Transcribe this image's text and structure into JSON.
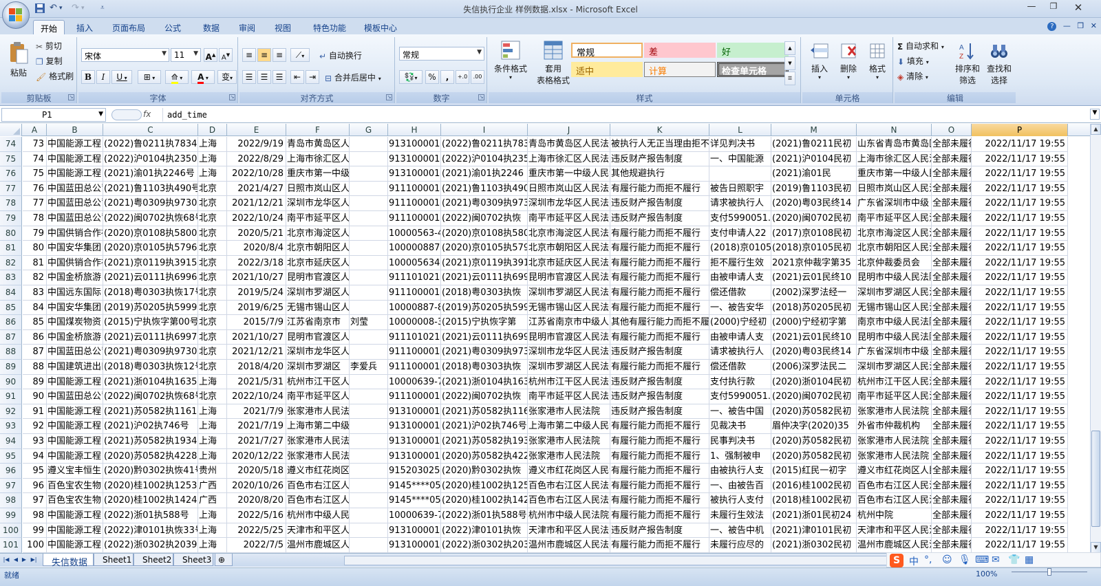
{
  "window": {
    "title": "失信执行企业 样例数据.xlsx - Microsoft Excel",
    "qat": [
      "save-icon",
      "undo-icon",
      "redo-icon"
    ],
    "controls": [
      "minimize-icon",
      "restore-icon",
      "close-icon"
    ]
  },
  "ribbon": {
    "tabs": [
      "开始",
      "插入",
      "页面布局",
      "公式",
      "数据",
      "审阅",
      "视图",
      "特色功能",
      "模板中心"
    ],
    "active_tab": "开始",
    "clipboard": {
      "paste": "粘贴",
      "cut": "剪切",
      "copy": "复制",
      "format_painter": "格式刷",
      "label": "剪贴板"
    },
    "font": {
      "name": "宋体",
      "size": "11",
      "label": "字体",
      "bold": "B",
      "italic": "I",
      "underline": "U",
      "grow": "A",
      "shrink": "A",
      "font_color_glyph": "A",
      "phonetic": "变"
    },
    "alignment": {
      "wrap": "自动换行",
      "merge": "合并后居中",
      "label": "对齐方式"
    },
    "number": {
      "format": "常规",
      "label": "数字",
      "percent": "%",
      "comma": ","
    },
    "styles": {
      "conditional": "条件格式",
      "table_format_1": "套用",
      "table_format_2": "表格格式",
      "label": "样式",
      "cells": [
        {
          "text": "常规",
          "bg": "#ffffff",
          "color": "#000000",
          "border": "#f0b060"
        },
        {
          "text": "差",
          "bg": "#ffc7ce",
          "color": "#9c0006",
          "border": "#ffc7ce"
        },
        {
          "text": "好",
          "bg": "#c6efce",
          "color": "#006100",
          "border": "#c6efce"
        },
        {
          "text": "适中",
          "bg": "#ffeb9c",
          "color": "#9c6500",
          "border": "#ffeb9c"
        },
        {
          "text": "计算",
          "bg": "#f2f2f2",
          "color": "#fa7d00",
          "border": "#7f7f7f"
        },
        {
          "text": "检查单元格",
          "bg": "#a5a5a5",
          "color": "#ffffff",
          "border": "#3f3f3f"
        }
      ]
    },
    "cells_group": {
      "insert": "插入",
      "delete": "删除",
      "format": "格式",
      "label": "单元格"
    },
    "editing": {
      "autosum": "自动求和",
      "fill": "填充",
      "clear": "清除",
      "sort_1": "排序和",
      "sort_2": "筛选",
      "find_1": "查找和",
      "find_2": "选择",
      "label": "编辑"
    }
  },
  "formula_bar": {
    "name_box": "P1",
    "fx": "fx",
    "content": "add_time"
  },
  "columns": [
    {
      "key": "A",
      "w": 35
    },
    {
      "key": "B",
      "w": 82
    },
    {
      "key": "C",
      "w": 138
    },
    {
      "key": "D",
      "w": 42
    },
    {
      "key": "E",
      "w": 86
    },
    {
      "key": "F",
      "w": 92
    },
    {
      "key": "G",
      "w": 56
    },
    {
      "key": "H",
      "w": 77
    },
    {
      "key": "I",
      "w": 126
    },
    {
      "key": "J",
      "w": 120
    },
    {
      "key": "K",
      "w": 144
    },
    {
      "key": "L",
      "w": 90
    },
    {
      "key": "M",
      "w": 124
    },
    {
      "key": "N",
      "w": 109
    },
    {
      "key": "O",
      "w": 58
    },
    {
      "key": "P",
      "w": 140
    }
  ],
  "selected_column": "P",
  "rows": [
    {
      "n": "74",
      "cells": [
        "73",
        "中国能源工程",
        "(2022)鲁0211执7834号",
        "上海",
        "2022/9/19",
        "青岛市黄岛区人民法院",
        "",
        "913100001",
        "(2022)鲁0211执7834",
        "青岛市黄岛区人民法院",
        "被执行人无正当理由拒不履行",
        "详见判决书",
        "(2021)鲁0211民初",
        "山东省青岛市黄岛区",
        "全部未履行",
        "2022/11/17 19:55"
      ]
    },
    {
      "n": "75",
      "cells": [
        "74",
        "中国能源工程",
        "(2022)沪0104执2350号",
        "上海",
        "2022/8/29",
        "上海市徐汇区人民法院",
        "",
        "913100001",
        "(2022)沪0104执2350",
        "上海市徐汇区人民法院",
        "违反财产报告制度",
        "一、中国能源",
        "(2021)沪0104民初",
        "上海市徐汇区人民法院",
        "全部未履行",
        "2022/11/17 19:55"
      ]
    },
    {
      "n": "76",
      "cells": [
        "75",
        "中国能源工程",
        "(2021)渝01执2246号",
        "上海",
        "2022/10/28",
        "重庆市第一中级人民法院",
        "",
        "913100001",
        "(2021)渝01执2246",
        "重庆市第一中级人民法院",
        "其他规避执行",
        "",
        "(2021)渝01民",
        "重庆市第一中级人民法院",
        "全部未履行",
        "2022/11/17 19:55"
      ]
    },
    {
      "n": "77",
      "cells": [
        "76",
        "中国蓝田总公司",
        "(2021)鲁1103执490号",
        "北京",
        "2021/4/27",
        "日照市岚山区人民法院",
        "",
        "911100001",
        "(2021)鲁1103执490",
        "日照市岚山区人民法院",
        "有履行能力而拒不履行",
        "被告日照职宇",
        "(2019)鲁1103民初",
        "日照市岚山区人民法院",
        "全部未履行",
        "2022/11/17 19:55"
      ]
    },
    {
      "n": "78",
      "cells": [
        "77",
        "中国蓝田总公司",
        "(2021)粤0309执9730号",
        "北京",
        "2021/12/21",
        "深圳市龙华区人民法院",
        "",
        "911100001",
        "(2021)粤0309执9730",
        "深圳市龙华区人民法院",
        "违反财产报告制度",
        "请求被执行人",
        "(2020)粤03民终14",
        "广东省深圳市中级",
        "全部未履行",
        "2022/11/17 19:55"
      ]
    },
    {
      "n": "79",
      "cells": [
        "78",
        "中国蓝田总公司",
        "(2022)闽0702执恢68号",
        "北京",
        "2022/10/24",
        "南平市延平区人民法院",
        "",
        "911100001",
        "(2022)闽0702执恢",
        "南平市延平区人民法院",
        "违反财产报告制度",
        "支付5990051.",
        "(2020)闽0702民初",
        "南平市延平区人民法院",
        "全部未履行",
        "2022/11/17 19:55"
      ]
    },
    {
      "n": "80",
      "cells": [
        "79",
        "中国供销合作社",
        "(2020)京0108执5800号",
        "北京",
        "2020/5/21",
        "北京市海淀区人民法院",
        "",
        "10000563-4",
        "(2020)京0108执5800",
        "北京市海淀区人民法院",
        "有履行能力而拒不履行",
        "支付申请人22",
        "(2017)京0108民初",
        "北京市海淀区人民法院",
        "全部未履行",
        "2022/11/17 19:55"
      ]
    },
    {
      "n": "81",
      "cells": [
        "80",
        "中国安华集团",
        "(2020)京0105执5796号",
        "北京",
        "2020/8/4",
        "北京市朝阳区人民法院",
        "",
        "100000887-8",
        "(2020)京0105执5796",
        "北京市朝阳区人民法院",
        "有履行能力而拒不履行",
        "(2018)京0105",
        "(2018)京0105民初",
        "北京市朝阳区人民法院",
        "全部未履行",
        "2022/11/17 19:55"
      ]
    },
    {
      "n": "82",
      "cells": [
        "81",
        "中国供销合作社",
        "(2021)京0119执3915号",
        "北京",
        "2022/3/18",
        "北京市延庆区人民法院",
        "",
        "100005634",
        "(2021)京0119执3915",
        "北京市延庆区人民法院",
        "有履行能力而拒不履行",
        "拒不履行生效",
        "2021京仲裁字第35",
        "北京仲裁委员会",
        "全部未履行",
        "2022/11/17 19:55"
      ]
    },
    {
      "n": "83",
      "cells": [
        "82",
        "中国金桥旅游",
        "(2021)云0111执6996号",
        "北京",
        "2021/10/27",
        "昆明市官渡区人民法院",
        "",
        "911101021",
        "(2021)云0111执6996",
        "昆明市官渡区人民法院",
        "有履行能力而拒不履行",
        "由被申请人支",
        "(2021)云01民终10",
        "昆明市中级人民法院",
        "全部未履行",
        "2022/11/17 19:55"
      ]
    },
    {
      "n": "84",
      "cells": [
        "83",
        "中国远东国际",
        "(2018)粤0303执恢17号",
        "北京",
        "2019/5/24",
        "深圳市罗湖区人民法院",
        "",
        "911100001",
        "(2018)粤0303执恢",
        "深圳市罗湖区人民法院",
        "有履行能力而拒不履行",
        "偿还借款",
        "(2002)深罗法经一",
        "深圳市罗湖区人民法院",
        "全部未履行",
        "2022/11/17 19:55"
      ]
    },
    {
      "n": "85",
      "cells": [
        "84",
        "中国安华集团",
        "(2019)苏0205执5999号",
        "北京",
        "2019/6/25",
        "无锡市锡山区人民法院",
        "",
        "10000887-8",
        "(2019)苏0205执5999",
        "无锡市锡山区人民法院",
        "有履行能力而拒不履行",
        "一、被告安华",
        "(2018)苏0205民初",
        "无锡市锡山区人民法院",
        "全部未履行",
        "2022/11/17 19:55"
      ]
    },
    {
      "n": "86",
      "cells": [
        "85",
        "中国煤炭物资",
        "(2015)宁执恢字第00号",
        "北京",
        "2015/7/9",
        "江苏省南京市",
        "刘莹",
        "10000008-3",
        "(2015)宁执恢字第",
        "江苏省南京市中级人民法院",
        "其他有履行能力而拒不履行",
        "(2000)宁经初",
        "(2000)宁经初字第",
        "南京市中级人民法院",
        "全部未履行",
        "2022/11/17 19:55"
      ]
    },
    {
      "n": "87",
      "cells": [
        "86",
        "中国金桥旅游",
        "(2021)云0111执6997号",
        "北京",
        "2021/10/27",
        "昆明市官渡区人民法院",
        "",
        "911101021",
        "(2021)云0111执6997",
        "昆明市官渡区人民法院",
        "有履行能力而拒不履行",
        "由被申请人支",
        "(2021)云01民终10",
        "昆明市中级人民法院",
        "全部未履行",
        "2022/11/17 19:55"
      ]
    },
    {
      "n": "88",
      "cells": [
        "87",
        "中国蓝田总公司",
        "(2021)粤0309执9730号",
        "北京",
        "2021/12/21",
        "深圳市龙华区人民法院",
        "",
        "911100001",
        "(2021)粤0309执9730",
        "深圳市龙华区人民法院",
        "违反财产报告制度",
        "请求被执行人",
        "(2020)粤03民终14",
        "广东省深圳市中级",
        "全部未履行",
        "2022/11/17 19:55"
      ]
    },
    {
      "n": "89",
      "cells": [
        "88",
        "中国建筑进出口",
        "(2018)粤0303执恢12号",
        "北京",
        "2018/4/20",
        "深圳市罗湖区",
        "李爱兵",
        "911100001",
        "(2018)粤0303执恢",
        "深圳市罗湖区人民法院",
        "有履行能力而拒不履行",
        "偿还借款",
        "(2006)深罗法民二",
        "深圳市罗湖区人民法院",
        "全部未履行",
        "2022/11/17 19:55"
      ]
    },
    {
      "n": "90",
      "cells": [
        "89",
        "中国能源工程",
        "(2021)浙0104执1635号",
        "上海",
        "2021/5/31",
        "杭州市江干区人民法院",
        "",
        "10000639-7",
        "(2021)浙0104执1635",
        "杭州市江干区人民法院",
        "违反财产报告制度",
        "支付执行款",
        "(2020)浙0104民初",
        "杭州市江干区人民法院",
        "全部未履行",
        "2022/11/17 19:55"
      ]
    },
    {
      "n": "91",
      "cells": [
        "90",
        "中国蓝田总公司",
        "(2022)闽0702执恢68号",
        "北京",
        "2022/10/24",
        "南平市延平区人民法院",
        "",
        "911100001",
        "(2022)闽0702执恢",
        "南平市延平区人民法院",
        "违反财产报告制度",
        "支付5990051.",
        "(2020)闽0702民初",
        "南平市延平区人民法院",
        "全部未履行",
        "2022/11/17 19:55"
      ]
    },
    {
      "n": "92",
      "cells": [
        "91",
        "中国能源工程",
        "(2021)苏0582执1161号",
        "上海",
        "2021/7/9",
        "张家港市人民法院",
        "",
        "913100001",
        "(2021)苏0582执1161",
        "张家港市人民法院",
        "违反财产报告制度",
        "一、被告中国",
        "(2020)苏0582民初",
        "张家港市人民法院",
        "全部未履行",
        "2022/11/17 19:55"
      ]
    },
    {
      "n": "93",
      "cells": [
        "92",
        "中国能源工程",
        "(2021)沪02执746号",
        "上海",
        "2021/7/19",
        "上海市第二中级人民法院",
        "",
        "913100001",
        "(2021)沪02执746号",
        "上海市第二中级人民法院",
        "有履行能力而拒不履行",
        "见裁决书",
        "眉仲决字(2020)35",
        "外省市仲裁机构",
        "全部未履行",
        "2022/11/17 19:55"
      ]
    },
    {
      "n": "94",
      "cells": [
        "93",
        "中国能源工程",
        "(2021)苏0582执1934号",
        "上海",
        "2021/7/27",
        "张家港市人民法院",
        "",
        "913100001",
        "(2021)苏0582执1934",
        "张家港市人民法院",
        "有履行能力而拒不履行",
        "民事判决书",
        "(2020)苏0582民初",
        "张家港市人民法院",
        "全部未履行",
        "2022/11/17 19:55"
      ]
    },
    {
      "n": "95",
      "cells": [
        "94",
        "中国能源工程",
        "(2020)苏0582执4228号",
        "上海",
        "2020/12/22",
        "张家港市人民法院",
        "",
        "913100001",
        "(2020)苏0582执4228",
        "张家港市人民法院",
        "有履行能力而拒不履行",
        "1、强制被申",
        "(2020)苏0582民初",
        "张家港市人民法院",
        "全部未履行",
        "2022/11/17 19:55"
      ]
    },
    {
      "n": "96",
      "cells": [
        "95",
        "遵义宝丰恒生",
        "(2020)黔0302执恢41号",
        "贵州",
        "2020/5/18",
        "遵义市红花岗区人民法院",
        "",
        "9152030255",
        "(2020)黔0302执恢",
        "遵义市红花岗区人民法院",
        "有履行能力而拒不履行",
        "由被执行人支",
        "(2015)红民一初字",
        "遵义市红花岗区人民法院",
        "全部未履行",
        "2022/11/17 19:55"
      ]
    },
    {
      "n": "97",
      "cells": [
        "96",
        "百色宝农生物",
        "(2020)桂1002执1253号",
        "广西",
        "2020/10/26",
        "百色市右江区人民法院",
        "",
        "9145****05",
        "(2020)桂1002执1253",
        "百色市右江区人民法院",
        "有履行能力而拒不履行",
        "一、由被告百",
        "(2016)桂1002民初",
        "百色市右江区人民法院",
        "全部未履行",
        "2022/11/17 19:55"
      ]
    },
    {
      "n": "98",
      "cells": [
        "97",
        "百色宝农生物",
        "(2020)桂1002执1424号",
        "广西",
        "2020/8/20",
        "百色市右江区人民法院",
        "",
        "9145****05",
        "(2020)桂1002执1424",
        "百色市右江区人民法院",
        "有履行能力而拒不履行",
        "被执行人支付",
        "(2018)桂1002民初",
        "百色市右江区人民法院",
        "全部未履行",
        "2022/11/17 19:55"
      ]
    },
    {
      "n": "99",
      "cells": [
        "98",
        "中国能源工程",
        "(2022)浙01执588号",
        "上海",
        "2022/5/16",
        "杭州市中级人民法院",
        "",
        "10000639-7",
        "(2022)浙01执588号",
        "杭州市中级人民法院",
        "有履行能力而拒不履行",
        "未履行生效法",
        "(2021)浙01民初24",
        "杭州中院",
        "全部未履行",
        "2022/11/17 19:55"
      ]
    },
    {
      "n": "100",
      "cells": [
        "99",
        "中国能源工程",
        "(2022)津0101执恢33号",
        "上海",
        "2022/5/25",
        "天津市和平区人民法院",
        "",
        "913100001",
        "(2022)津0101执恢",
        "天津市和平区人民法院",
        "违反财产报告制度",
        "一、被告中机",
        "(2021)津0101民初",
        "天津市和平区人民法院",
        "全部未履行",
        "2022/11/17 19:55"
      ]
    },
    {
      "n": "101",
      "cells": [
        "100",
        "中国能源工程",
        "(2022)浙0302执2039号",
        "上海",
        "2022/7/5",
        "温州市鹿城区人民法院",
        "",
        "913100001",
        "(2022)浙0302执2039",
        "温州市鹿城区人民法院",
        "有履行能力而拒不履行",
        "未履行应尽的",
        "(2021)浙0302民初",
        "温州市鹿城区人民法院",
        "全部未履行",
        "2022/11/17 19:55"
      ]
    }
  ],
  "right_aligned_cols": [
    0,
    4,
    15
  ],
  "sheets": [
    "失信数据",
    "Sheet1",
    "Sheet2",
    "Sheet3"
  ],
  "active_sheet": "失信数据",
  "ime": {
    "logo": "S",
    "mode": "中",
    "punct": "°,"
  },
  "status": {
    "text": "就绪",
    "zoom": "100%"
  }
}
